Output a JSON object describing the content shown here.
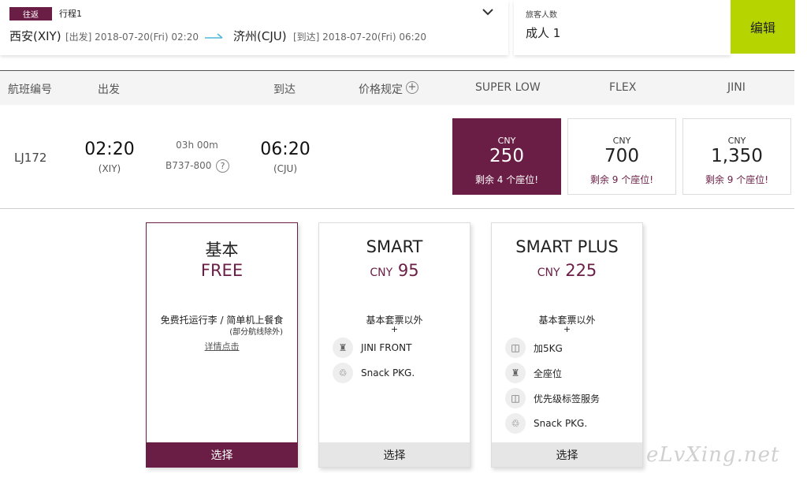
{
  "colors": {
    "brand": "#6b1e45",
    "accent": "#b5d400"
  },
  "trip": {
    "tag": "往返",
    "name": "行程1",
    "dep_city": "西安(XIY)",
    "dep_meta": "[出发] 2018-07-20(Fri) 02:20",
    "arr_city": "济州(CJU)",
    "arr_meta": "[到达] 2018-07-20(Fri) 06:20"
  },
  "passengers": {
    "label": "旅客人数",
    "value": "成人 1"
  },
  "edit_label": "编辑",
  "columns": {
    "flight_no": "航班编号",
    "depart": "出发",
    "arrive": "到达",
    "fare_rules": "价格规定",
    "super_low": "SUPER LOW",
    "flex": "FLEX",
    "jini": "JINI"
  },
  "flight": {
    "number": "LJ172",
    "dep_time": "02:20",
    "dep_code": "(XIY)",
    "duration": "03h 00m",
    "aircraft": "B737-800",
    "arr_time": "06:20",
    "arr_code": "(CJU)"
  },
  "fares": [
    {
      "currency": "CNY",
      "amount": "250",
      "seats": "剩余 4 个座位!",
      "selected": true
    },
    {
      "currency": "CNY",
      "amount": "700",
      "seats": "剩余 9 个座位!",
      "selected": false
    },
    {
      "currency": "CNY",
      "amount": "1,350",
      "seats": "剩余 9 个座位!",
      "selected": false
    }
  ],
  "bundles": {
    "basic": {
      "title": "基本",
      "price": "FREE",
      "desc": "免费托运行李 / 简单机上餐食",
      "note": "(部分航线除外)",
      "link": "详情点击",
      "select": "选择"
    },
    "smart": {
      "title": "SMART",
      "currency": "CNY",
      "price": "95",
      "desc": "基本套票以外",
      "plus": "+",
      "features": [
        {
          "icon": "seat-icon",
          "label": "JINI FRONT"
        },
        {
          "icon": "meal-icon",
          "label": "Snack PKG."
        }
      ],
      "select": "选择"
    },
    "smart_plus": {
      "title": "SMART PLUS",
      "currency": "CNY",
      "price": "225",
      "desc": "基本套票以外",
      "plus": "+",
      "features": [
        {
          "icon": "baggage-icon",
          "label": "加5KG"
        },
        {
          "icon": "seat-icon",
          "label": "全座位"
        },
        {
          "icon": "priority-tag-icon",
          "label": "优先级标签服务"
        },
        {
          "icon": "meal-icon",
          "label": "Snack PKG."
        }
      ],
      "select": "选择"
    }
  },
  "watermark": "eLvXing.net"
}
